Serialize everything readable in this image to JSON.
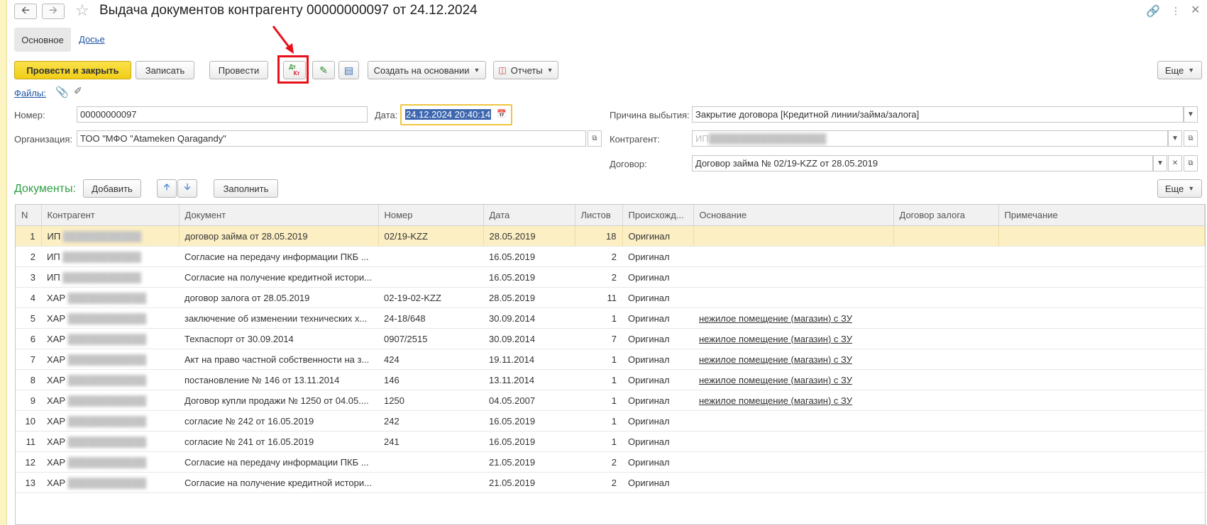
{
  "window": {
    "title": "Выдача документов контрагенту 00000000097 от 24.12.2024"
  },
  "tabs": [
    "Основное",
    "Досье"
  ],
  "toolbar": {
    "post_close": "Провести и закрыть",
    "save": "Записать",
    "post": "Провести",
    "dtkt_top": "Дт",
    "dtkt_bottom": "Кт",
    "create_based": "Создать на основании",
    "reports": "Отчеты",
    "more": "Еще"
  },
  "files_link": "Файлы:",
  "form": {
    "number_label": "Номер:",
    "number_value": "00000000097",
    "date_label": "Дата:",
    "date_value": "24.12.2024 20:40:14",
    "org_label": "Организация:",
    "org_value": "ТОО \"МФО \"Atameken Qaragandy\"",
    "reason_label": "Причина выбытия:",
    "reason_value": "Закрытие договора [Кредитной линии/займа/залога]",
    "counterparty_label": "Контрагент:",
    "counterparty_value": "ИП",
    "contract_label": "Договор:",
    "contract_value": "Договор займа № 02/19-KZZ от 28.05.2019"
  },
  "documents": {
    "title": "Документы:",
    "add": "Добавить",
    "fill": "Заполнить",
    "more": "Еще",
    "columns": [
      "N",
      "Контрагент",
      "Документ",
      "Номер",
      "Дата",
      "Листов",
      "Происхожд...",
      "Основание",
      "Договор залога",
      "Примечание"
    ],
    "rows": [
      {
        "n": "1",
        "cp": "ИП",
        "doc": "договор займа от 28.05.2019",
        "num": "02/19-KZZ",
        "date": "28.05.2019",
        "sheets": "18",
        "origin": "Оригинал",
        "basis": ""
      },
      {
        "n": "2",
        "cp": "ИП",
        "doc": "Согласие на передачу информации ПКБ ...",
        "num": "",
        "date": "16.05.2019",
        "sheets": "2",
        "origin": "Оригинал",
        "basis": ""
      },
      {
        "n": "3",
        "cp": "ИП",
        "doc": "Согласие на получение кредитной истори...",
        "num": "",
        "date": "16.05.2019",
        "sheets": "2",
        "origin": "Оригинал",
        "basis": ""
      },
      {
        "n": "4",
        "cp": "ХАР",
        "doc": "договор залога от 28.05.2019",
        "num": "02-19-02-KZZ",
        "date": "28.05.2019",
        "sheets": "11",
        "origin": "Оригинал",
        "basis": ""
      },
      {
        "n": "5",
        "cp": "ХАР",
        "doc": "заключение об изменении технических х...",
        "num": "24-18/648",
        "date": "30.09.2014",
        "sheets": "1",
        "origin": "Оригинал",
        "basis": "нежилое помещение (магазин) с ЗУ"
      },
      {
        "n": "6",
        "cp": "ХАР",
        "doc": "Техпаспорт от 30.09.2014",
        "num": "0907/2515",
        "date": "30.09.2014",
        "sheets": "7",
        "origin": "Оригинал",
        "basis": "нежилое помещение (магазин) с ЗУ"
      },
      {
        "n": "7",
        "cp": "ХАР",
        "doc": "Акт на право частной собственности на з...",
        "num": "424",
        "date": "19.11.2014",
        "sheets": "1",
        "origin": "Оригинал",
        "basis": "нежилое помещение (магазин) с ЗУ"
      },
      {
        "n": "8",
        "cp": "ХАР",
        "doc": "постановление № 146 от 13.11.2014",
        "num": "146",
        "date": "13.11.2014",
        "sheets": "1",
        "origin": "Оригинал",
        "basis": "нежилое помещение (магазин) с ЗУ"
      },
      {
        "n": "9",
        "cp": "ХАР",
        "doc": "Договор купли продажи № 1250 от 04.05....",
        "num": "1250",
        "date": "04.05.2007",
        "sheets": "1",
        "origin": "Оригинал",
        "basis": "нежилое помещение (магазин) с ЗУ"
      },
      {
        "n": "10",
        "cp": "ХАР",
        "doc": "согласие № 242 от 16.05.2019",
        "num": "242",
        "date": "16.05.2019",
        "sheets": "1",
        "origin": "Оригинал",
        "basis": ""
      },
      {
        "n": "11",
        "cp": "ХАР",
        "doc": "согласие № 241 от 16.05.2019",
        "num": "241",
        "date": "16.05.2019",
        "sheets": "1",
        "origin": "Оригинал",
        "basis": ""
      },
      {
        "n": "12",
        "cp": "ХАР",
        "doc": "Согласие на передачу информации ПКБ ...",
        "num": "",
        "date": "21.05.2019",
        "sheets": "2",
        "origin": "Оригинал",
        "basis": ""
      },
      {
        "n": "13",
        "cp": "ХАР",
        "doc": "Согласие на получение кредитной истори...",
        "num": "",
        "date": "21.05.2019",
        "sheets": "2",
        "origin": "Оригинал",
        "basis": ""
      }
    ]
  },
  "colors": {
    "accent_yellow": "#f5d320",
    "section_green": "#2e9e44",
    "selection": "#fdefc4",
    "highlight_red": "#e8101a",
    "link_blue": "#1f56a6"
  },
  "icons": [
    "back-arrow-icon",
    "forward-arrow-icon",
    "star-icon",
    "link-icon",
    "kebab-icon",
    "close-icon",
    "paperclip-icon",
    "pencil-icon",
    "edit-clock-icon",
    "structure-icon",
    "report-icon",
    "arrow-up-icon",
    "arrow-down-icon",
    "calendar-icon",
    "open-icon",
    "dropdown-icon"
  ]
}
